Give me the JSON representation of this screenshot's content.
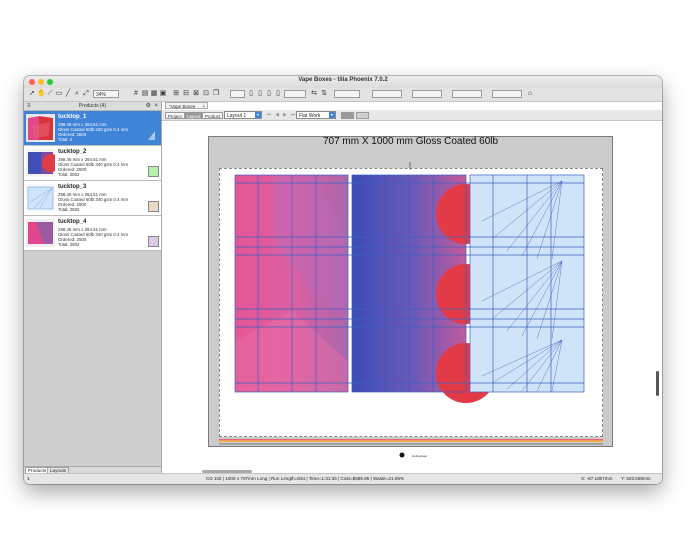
{
  "window": {
    "title": "Vape Boxes - tilia Phoenix 7.0.2"
  },
  "toolbar": {
    "zoom": "34%",
    "hash": "#"
  },
  "sidebar": {
    "header": "Products (4)",
    "products": [
      {
        "name": "tucktop_1",
        "size": "298.45 mm x 284.51 mm",
        "stock": "Gloss Coated 60lb 340 gsm 0.4 mm",
        "ordered": "Ordered: 2500",
        "total": "Total: 0",
        "selected": true,
        "swatch": "#8fb8e8"
      },
      {
        "name": "tucktop_2",
        "size": "298.45 mm x 284.51 mm",
        "stock": "Gloss Coated 60lb 340 gsm 0.4 mm",
        "ordered": "Ordered: 2500",
        "total": "Total: 2502",
        "selected": false,
        "swatch": "#b7f0a8"
      },
      {
        "name": "tucktop_3",
        "size": "298.45 mm x 284.51 mm",
        "stock": "Gloss Coated 60lb 340 gsm 0.4 mm",
        "ordered": "Ordered: 2500",
        "total": "Total: 2502",
        "selected": false,
        "swatch": "#ead8c4"
      },
      {
        "name": "tucktop_4",
        "size": "298.45 mm x 284.51 mm",
        "stock": "Gloss Coated 60lb 340 gsm 0.4 mm",
        "ordered": "Ordered: 2500",
        "total": "Total: 2502",
        "selected": false,
        "swatch": "#dcc8e8"
      }
    ],
    "tabs": [
      "Products",
      "Layouts"
    ]
  },
  "document": {
    "tab": "*Vape Boxes",
    "view_buttons": [
      "Project",
      "Layout",
      "Product"
    ],
    "layout_select": "Layout 1",
    "work_select": "Flat Work",
    "sheet_title": "707 mm X 1000 mm Gloss Coated 60lb",
    "marks_label": "Holtegraaw"
  },
  "status": {
    "page": "1",
    "summary": "CD 102  |  1000 x 707mm Long  |  Run Length=834  |  Time=1:31:36  |  Cost=$589.95  |  Waste=21.96%",
    "x": "X:  -87.1807mm",
    "y": "Y:  503.569mm"
  },
  "colors": {
    "pink": "#e2478c",
    "blue": "#4150b8",
    "light_blue": "#cfe4f8",
    "red": "#e23a46",
    "die_line": "#3d5fc2",
    "accent": "#3f84d7"
  }
}
